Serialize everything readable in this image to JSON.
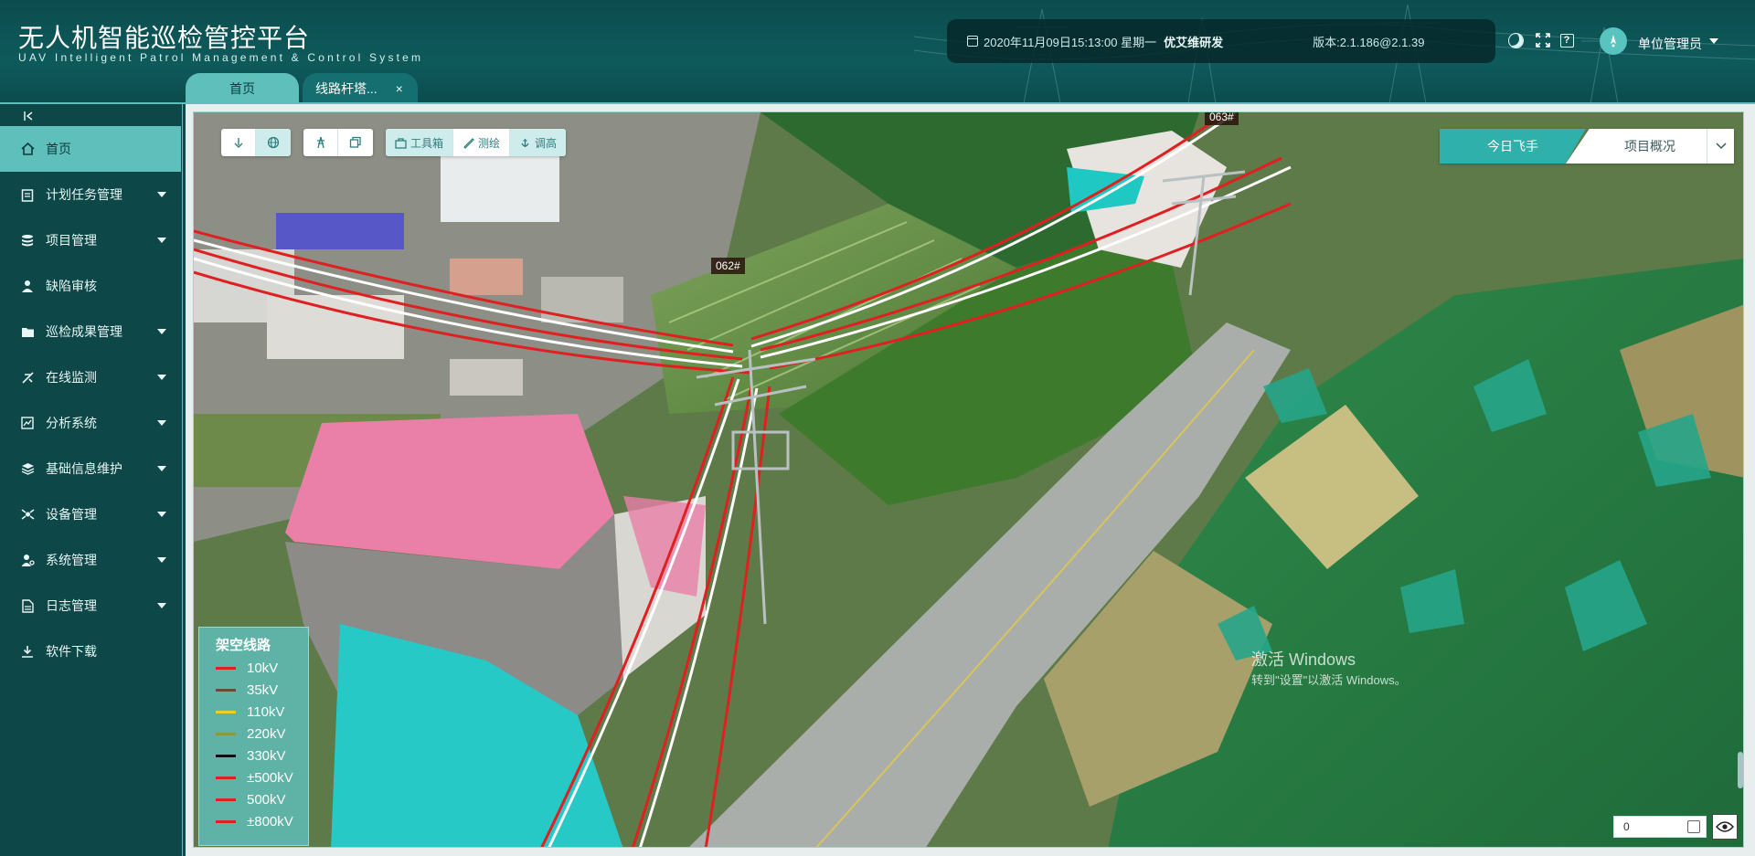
{
  "app": {
    "title": "无人机智能巡检管控平台",
    "subtitle": "UAV Intelligent Patrol Management & Control System"
  },
  "header_info": {
    "datetime": "2020年11月09日15:13:00 星期一",
    "developer": "优艾维研发",
    "version": "版本:2.1.186@2.1.39"
  },
  "user": {
    "name": "单位管理员",
    "icons": [
      "moon-icon",
      "fullscreen-icon",
      "help-icon",
      "avatar-icon"
    ]
  },
  "tabs": [
    {
      "label": "首页"
    },
    {
      "label": "线路杆塔...",
      "close": "×"
    }
  ],
  "sidebar": {
    "items": [
      {
        "label": "首页",
        "icon": "home-icon",
        "active": true,
        "has_children": false
      },
      {
        "label": "计划任务管理",
        "icon": "clipboard-icon",
        "has_children": true
      },
      {
        "label": "项目管理",
        "icon": "database-icon",
        "has_children": true
      },
      {
        "label": "缺陷审核",
        "icon": "user-icon",
        "has_children": false
      },
      {
        "label": "巡检成果管理",
        "icon": "folder-icon",
        "has_children": true
      },
      {
        "label": "在线监测",
        "icon": "drone-icon",
        "has_children": true
      },
      {
        "label": "分析系统",
        "icon": "chart-icon",
        "has_children": true
      },
      {
        "label": "基础信息维护",
        "icon": "layers-icon",
        "has_children": true
      },
      {
        "label": "设备管理",
        "icon": "satellite-icon",
        "has_children": true
      },
      {
        "label": "系统管理",
        "icon": "user-gear-icon",
        "has_children": true
      },
      {
        "label": "日志管理",
        "icon": "document-icon",
        "has_children": true
      },
      {
        "label": "软件下载",
        "icon": "download-icon",
        "has_children": false
      }
    ]
  },
  "toolbar": {
    "group1": [
      "marker-icon",
      "globe-icon"
    ],
    "group2": [
      "tower-icon",
      "copy-icon"
    ],
    "tools_label": "工具箱",
    "measure_label": "测绘",
    "height_label": "调高"
  },
  "mode_switch": {
    "active": "今日飞手",
    "other": "项目概况"
  },
  "towers": [
    {
      "label": "062#"
    },
    {
      "label": "063#"
    }
  ],
  "legend": {
    "title": "架空线路",
    "items": [
      {
        "label": "10kV",
        "color": "#e02020"
      },
      {
        "label": "35kV",
        "color": "#6b4a3a"
      },
      {
        "label": "110kV",
        "color": "#e8d21e"
      },
      {
        "label": "220kV",
        "color": "#8a9a3a"
      },
      {
        "label": "330kV",
        "color": "#111111"
      },
      {
        "label": "±500kV",
        "color": "#e02020"
      },
      {
        "label": "500kV",
        "color": "#e02020"
      },
      {
        "label": "±800kV",
        "color": "#e02020"
      }
    ]
  },
  "watermark": {
    "line1": "激活 Windows",
    "line2": "转到\"设置\"以激活 Windows。"
  },
  "coord_input": {
    "value": "0"
  },
  "colors": {
    "accent": "#5fc0bb",
    "header_bg": "#0c4c4e",
    "sidebar_bg": "#0d4748"
  }
}
